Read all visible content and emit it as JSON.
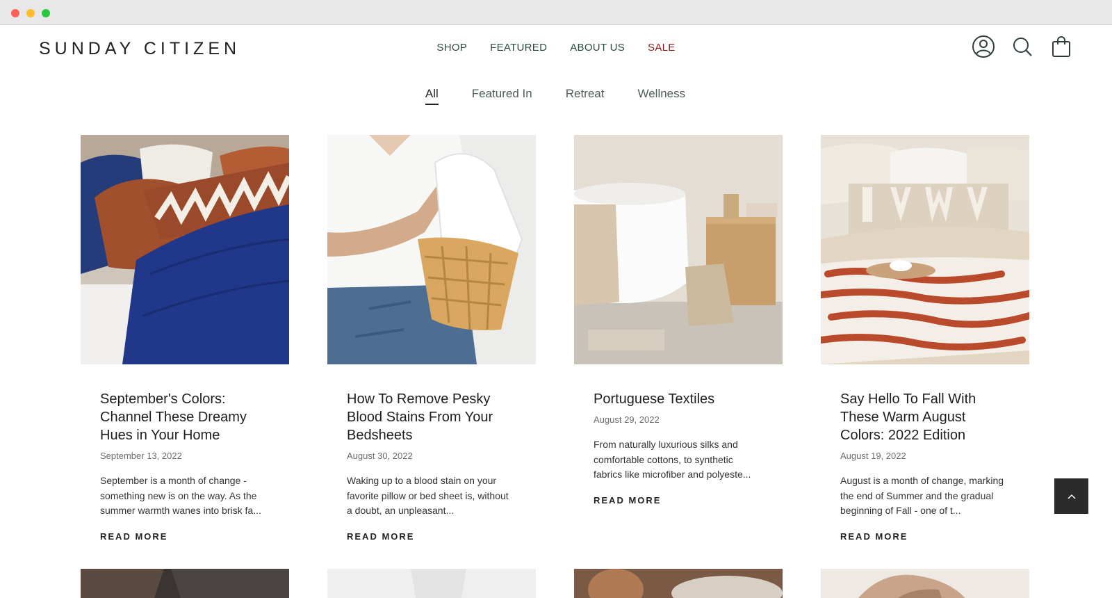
{
  "brand": {
    "logo": "SUNDAY CITIZEN"
  },
  "nav": [
    {
      "label": "SHOP"
    },
    {
      "label": "FEATURED"
    },
    {
      "label": "ABOUT US"
    },
    {
      "label": "SALE"
    }
  ],
  "header_icons": [
    "account-icon",
    "search-icon",
    "shopping-bag-icon"
  ],
  "filters": [
    {
      "label": "All",
      "active": true
    },
    {
      "label": "Featured In"
    },
    {
      "label": "Retreat"
    },
    {
      "label": "Wellness"
    }
  ],
  "posts": [
    {
      "title": "September's Colors: Channel These Dreamy Hues in Your Home",
      "date": "September 13, 2022",
      "excerpt": "September is a month of change - something new is on the way. As the summer warmth wanes into brisk fa...",
      "more": "READ MORE"
    },
    {
      "title": "How To Remove Pesky Blood Stains From Your Bedsheets",
      "date": "August 30, 2022",
      "excerpt": "Waking up to a blood stain on your favorite pillow or bed sheet is, without a doubt, an unpleasant...",
      "more": "READ MORE"
    },
    {
      "title": "Portuguese Textiles",
      "date": "August 29, 2022",
      "excerpt": "From naturally luxurious silks and comfortable cottons, to synthetic fabrics like microfiber and polyeste...",
      "more": "READ MORE"
    },
    {
      "title": "Say Hello To Fall With These Warm August Colors: 2022 Edition",
      "date": "August 19, 2022",
      "excerpt": "August is a month of change, marking the end of Summer and the gradual beginning of Fall - one of t...",
      "more": "READ MORE"
    }
  ],
  "colors": {
    "nav_text": "#2d4a3e",
    "sale": "#8b1a1a",
    "back_to_top": "#2b2b2b"
  }
}
